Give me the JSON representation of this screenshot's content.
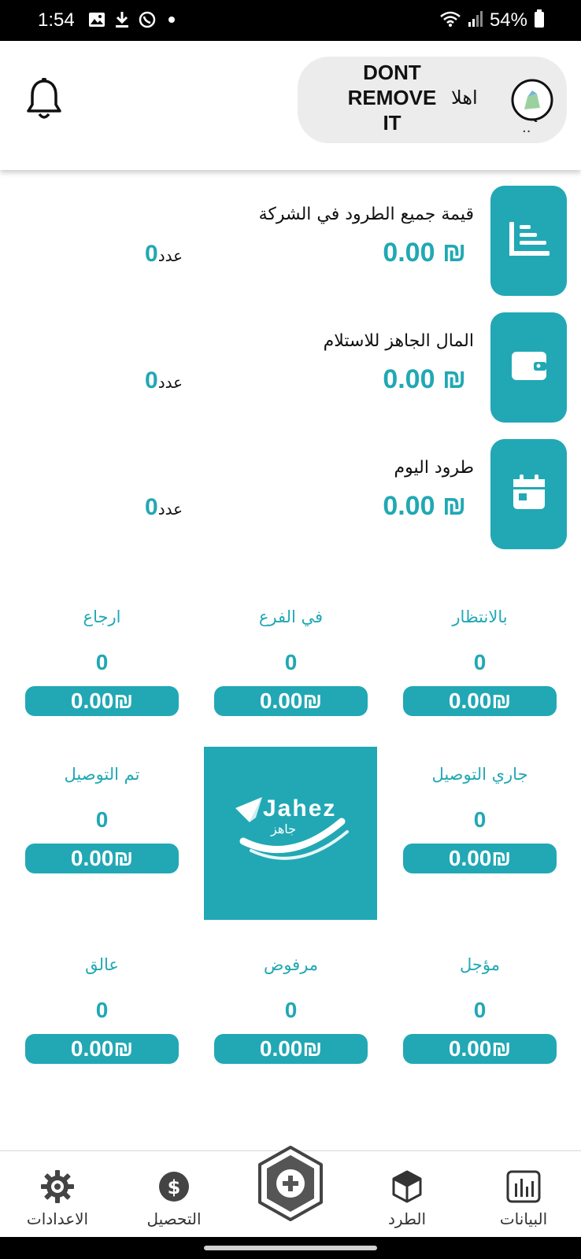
{
  "status_bar": {
    "time": "1:54",
    "battery": "54%"
  },
  "header": {
    "user_name": "DONT REMOVE IT",
    "greeting": "اهلا",
    "avatar_suffix": ".."
  },
  "cards": [
    {
      "title": "قيمة جميع الطرود في الشركة",
      "amount": "0.00 ₪",
      "count": "0",
      "count_unit": "عدد",
      "icon": "chart-icon"
    },
    {
      "title": "المال الجاهز للاستلام",
      "amount": "0.00 ₪",
      "count": "0",
      "count_unit": "عدد",
      "icon": "wallet-icon"
    },
    {
      "title": "طرود اليوم",
      "amount": "0.00 ₪",
      "count": "0",
      "count_unit": "عدد",
      "icon": "calendar-icon"
    }
  ],
  "stats": [
    {
      "label": "بالانتظار",
      "count": "0",
      "amount": "0.00₪"
    },
    {
      "label": "في الفرع",
      "count": "0",
      "amount": "0.00₪"
    },
    {
      "label": "ارجاع",
      "count": "0",
      "amount": "0.00₪"
    },
    {
      "label": "جاري التوصيل",
      "count": "0",
      "amount": "0.00₪"
    },
    {
      "label": "تم التوصيل",
      "count": "0",
      "amount": "0.00₪"
    },
    {
      "label": "مؤجل",
      "count": "0",
      "amount": "0.00₪"
    },
    {
      "label": "مرفوض",
      "count": "0",
      "amount": "0.00₪"
    },
    {
      "label": "عالق",
      "count": "0",
      "amount": "0.00₪"
    }
  ],
  "logo": {
    "text": "Jahez"
  },
  "bottom_nav": {
    "data": "البيانات",
    "parcel": "الطرد",
    "collection": "التحصيل",
    "settings": "الاعدادات"
  },
  "colors": {
    "accent": "#21a8b4"
  }
}
